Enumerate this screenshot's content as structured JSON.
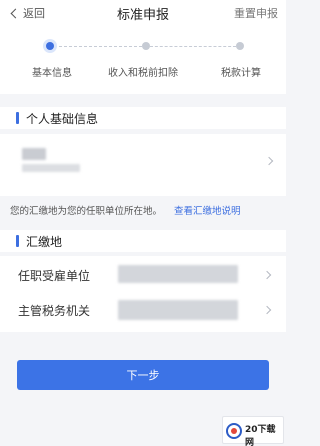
{
  "nav": {
    "back_label": "返回",
    "title": "标准申报",
    "reset_label": "重置申报"
  },
  "steps": [
    {
      "label": "基本信息",
      "state": "active"
    },
    {
      "label": "收入和税前扣除",
      "state": "pending"
    },
    {
      "label": "税款计算",
      "state": "pending"
    }
  ],
  "personal": {
    "heading": "个人基础信息"
  },
  "hint": {
    "text": "您的汇缴地为您的任职单位所在地。",
    "link": "查看汇缴地说明"
  },
  "filing": {
    "heading": "汇缴地",
    "employer_label": "任职受雇单位",
    "tax_office_label": "主管税务机关"
  },
  "next_button": "下一步",
  "watermark": {
    "text": "20下载网"
  },
  "colors": {
    "accent": "#3c73e6",
    "background": "#f4f5f8"
  }
}
